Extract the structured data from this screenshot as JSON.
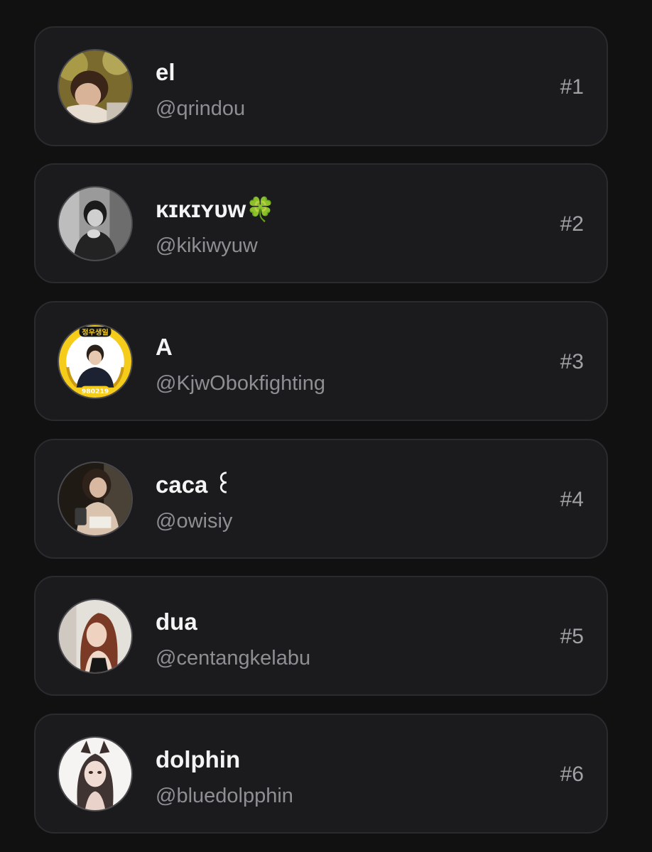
{
  "users": [
    {
      "display_name": "el",
      "handle": "@qrindou",
      "rank": "#1",
      "avatar_icon": "user-avatar-photo"
    },
    {
      "display_name": "ᴋɪᴋɪʏᴜᴡ🍀",
      "handle": "@kikiwyuw",
      "rank": "#2",
      "avatar_icon": "user-avatar-photo"
    },
    {
      "display_name": "A",
      "handle": "@KjwObokfighting",
      "rank": "#3",
      "avatar_icon": "user-avatar-photo",
      "avatar_badge_text": "정우생일",
      "avatar_badge_number": "980219"
    },
    {
      "display_name": "caca ꒰",
      "handle": "@owisiy",
      "rank": "#4",
      "avatar_icon": "user-avatar-photo"
    },
    {
      "display_name": "dua",
      "handle": "@centangkelabu",
      "rank": "#5",
      "avatar_icon": "user-avatar-photo"
    },
    {
      "display_name": "dolphin",
      "handle": "@bluedolpphin",
      "rank": "#6",
      "avatar_icon": "user-avatar-photo"
    }
  ],
  "colors": {
    "background": "#111112",
    "card": "#1b1b1d",
    "card_border": "#2b2b2f",
    "name_text": "#f4f4f5",
    "handle_text": "#8e8e93",
    "rank_text": "#a1a1a6",
    "badge_yellow": "#f5cc1a"
  }
}
